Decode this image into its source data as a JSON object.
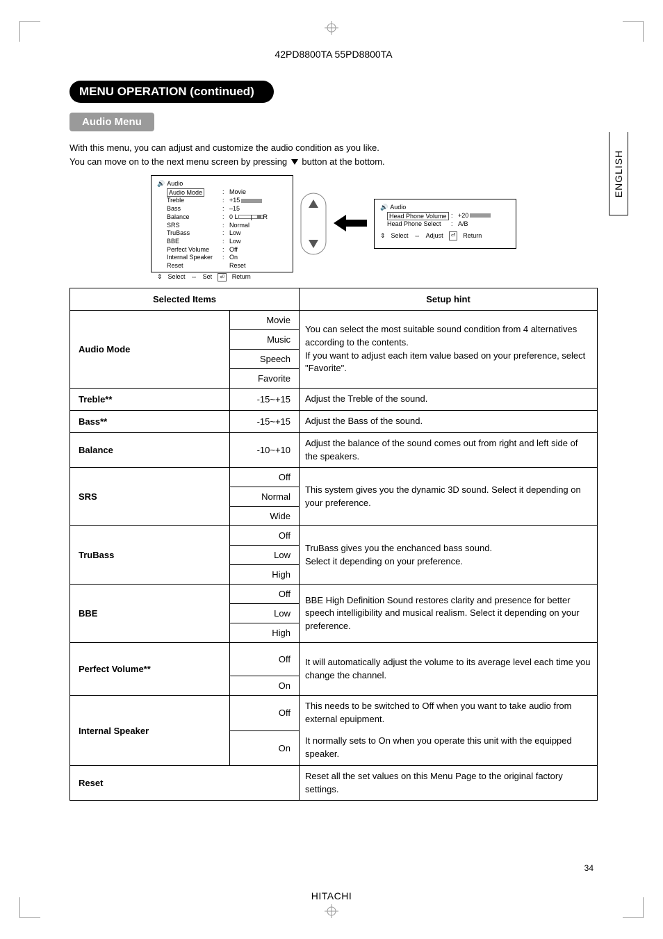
{
  "header": {
    "model": "42PD8800TA  55PD8800TA"
  },
  "section_title": "MENU OPERATION (continued)",
  "subsection_title": "Audio Menu",
  "intro_line1": "With this menu, you can adjust and customize the audio condition as you like.",
  "intro_line2a": "You can move on to the next menu screen by pressing ",
  "intro_line2b": "button at the bottom.",
  "lang_tab": "ENGLISH",
  "osd_left": {
    "title": "Audio",
    "rows": [
      {
        "name": "Audio Mode",
        "val": "Movie",
        "highlight": true
      },
      {
        "name": "Treble",
        "val": "+15",
        "bar": true
      },
      {
        "name": "Bass",
        "val": "–15"
      },
      {
        "name": "Balance",
        "val": "0",
        "bal": true,
        "balL": "L",
        "balR": "R"
      },
      {
        "name": "SRS",
        "val": "Normal"
      },
      {
        "name": "TruBass",
        "val": "Low"
      },
      {
        "name": "BBE",
        "val": "Low"
      },
      {
        "name": "Perfect Volume",
        "val": "Off"
      },
      {
        "name": "Internal Speaker",
        "val": "On"
      },
      {
        "name": "Reset",
        "val": "Reset"
      }
    ],
    "footer": {
      "select": "Select",
      "set": "Set",
      "ret": "Return"
    }
  },
  "osd_right": {
    "title": "Audio",
    "rows": [
      {
        "name": "Head Phone Volume",
        "val": "+20",
        "highlight": true,
        "bar": true
      },
      {
        "name": "Head Phone Select",
        "val": "A/B"
      }
    ],
    "footer": {
      "select": "Select",
      "adjust": "Adjust",
      "ret": "Return"
    }
  },
  "table": {
    "headers": {
      "items": "Selected Items",
      "hint": "Setup hint"
    },
    "rows": [
      {
        "item": "Audio Mode",
        "values": [
          "Movie",
          "Music",
          "Speech",
          "Favorite"
        ],
        "hint": "You can select the most suitable sound condition from 4 alternatives according to the contents.\nIf you want to adjust each item value based on your preference, select \"Favorite\"."
      },
      {
        "item": "Treble**",
        "values": [
          "-15~+15"
        ],
        "hint": "Adjust the Treble of the sound."
      },
      {
        "item": "Bass**",
        "values": [
          "-15~+15"
        ],
        "hint": "Adjust the Bass of the sound."
      },
      {
        "item": "Balance",
        "values": [
          "-10~+10"
        ],
        "hint": "Adjust the balance of the sound comes out from right and left side of the speakers."
      },
      {
        "item": "SRS",
        "values": [
          "Off",
          "Normal",
          "Wide"
        ],
        "hint": "This system gives you the dynamic 3D sound. Select it depending on your preference."
      },
      {
        "item": "TruBass",
        "values": [
          "Off",
          "Low",
          "High"
        ],
        "hint": "TruBass gives you the enchanced bass sound.\nSelect it depending on your preference."
      },
      {
        "item": "BBE",
        "values": [
          "Off",
          "Low",
          "High"
        ],
        "hint": "BBE High Definition Sound restores clarity and presence for better speech intelligibility and musical realism. Select it depending on your preference."
      },
      {
        "item": "Perfect Volume**",
        "values": [
          "Off",
          "On"
        ],
        "hint": "It will automatically adjust the volume to its average level each time you change the channel."
      },
      {
        "item": "Internal Speaker",
        "values": [
          "Off",
          "On"
        ],
        "hint_multi": [
          "This needs to be switched to Off when you want to take audio from external epuipment.",
          "It normally sets to On when you operate this unit with the equipped speaker."
        ]
      },
      {
        "item": "Reset",
        "values": [],
        "hint": "Reset all the set values on this Menu Page to the original factory settings."
      }
    ]
  },
  "footer_brand": "HITACHI",
  "page_num": "34"
}
